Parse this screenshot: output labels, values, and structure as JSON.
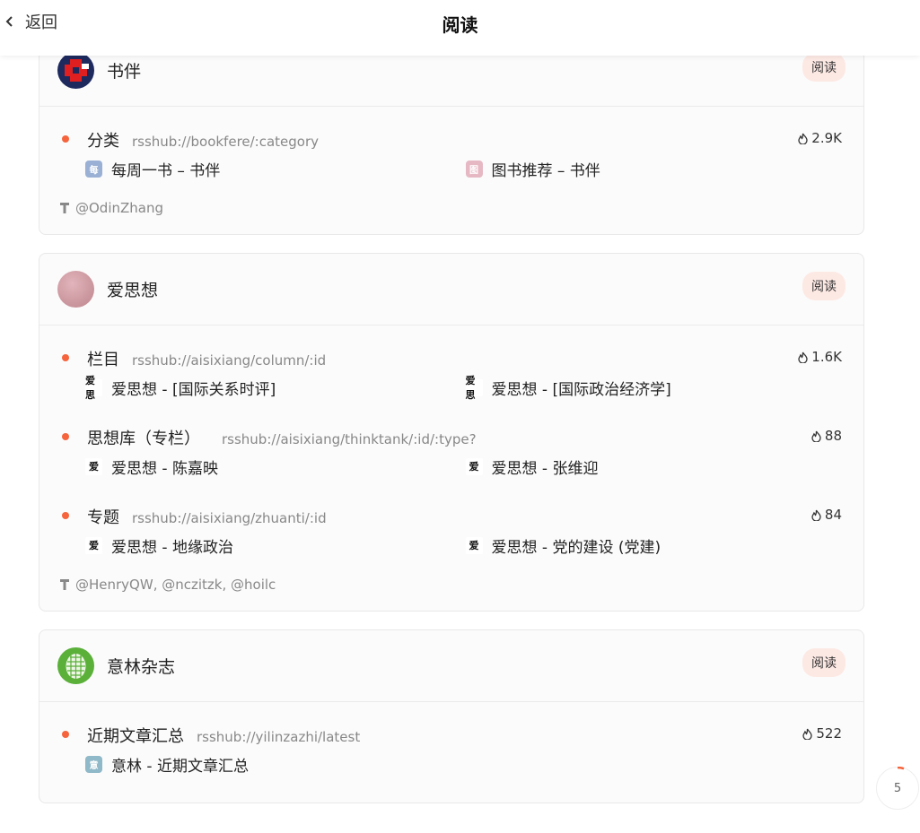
{
  "header": {
    "back_label": "返回",
    "title": "阅读"
  },
  "cards": [
    {
      "site": "书伴",
      "category": "阅读",
      "routes": [
        {
          "name": "分类",
          "path": "rsshub://bookfere/:category",
          "heat": "2.9K",
          "examples": [
            {
              "icon_text": "每",
              "label": "每周一书 – 书伴"
            },
            {
              "icon_text": "图",
              "label": "图书推荐 – 书伴"
            }
          ]
        }
      ],
      "maintainers": "@OdinZhang"
    },
    {
      "site": "爱思想",
      "category": "阅读",
      "routes": [
        {
          "name": "栏目",
          "path": "rsshub://aisixiang/column/:id",
          "heat": "1.6K",
          "examples": [
            {
              "icon_text": "爱思",
              "label": "爱思想 - [国际关系时评]"
            },
            {
              "icon_text": "爱思",
              "label": "爱思想 - [国际政治经济学]"
            }
          ]
        },
        {
          "name": "思想库（专栏）",
          "path": "rsshub://aisixiang/thinktank/:id/:type?",
          "heat": "88",
          "examples": [
            {
              "icon_text": "爱",
              "label": "爱思想 - 陈嘉映"
            },
            {
              "icon_text": "爱",
              "label": "爱思想 - 张维迎"
            }
          ]
        },
        {
          "name": "专题",
          "path": "rsshub://aisixiang/zhuanti/:id",
          "heat": "84",
          "examples": [
            {
              "icon_text": "爱",
              "label": "爱思想 - 地缘政治"
            },
            {
              "icon_text": "爱",
              "label": "爱思想 - 党的建设 (党建)"
            }
          ]
        }
      ],
      "maintainers": "@HenryQW, @nczitzk, @hoilc"
    },
    {
      "site": "意林杂志",
      "category": "阅读",
      "routes": [
        {
          "name": "近期文章汇总",
          "path": "rsshub://yilinzazhi/latest",
          "heat": "522",
          "examples": [
            {
              "icon_text": "意",
              "label": "意林 - 近期文章汇总"
            }
          ]
        }
      ]
    }
  ],
  "scroll_indicator": "5",
  "colors": {
    "accent": "#f5643c",
    "badge_bg": "#fde9e4"
  }
}
